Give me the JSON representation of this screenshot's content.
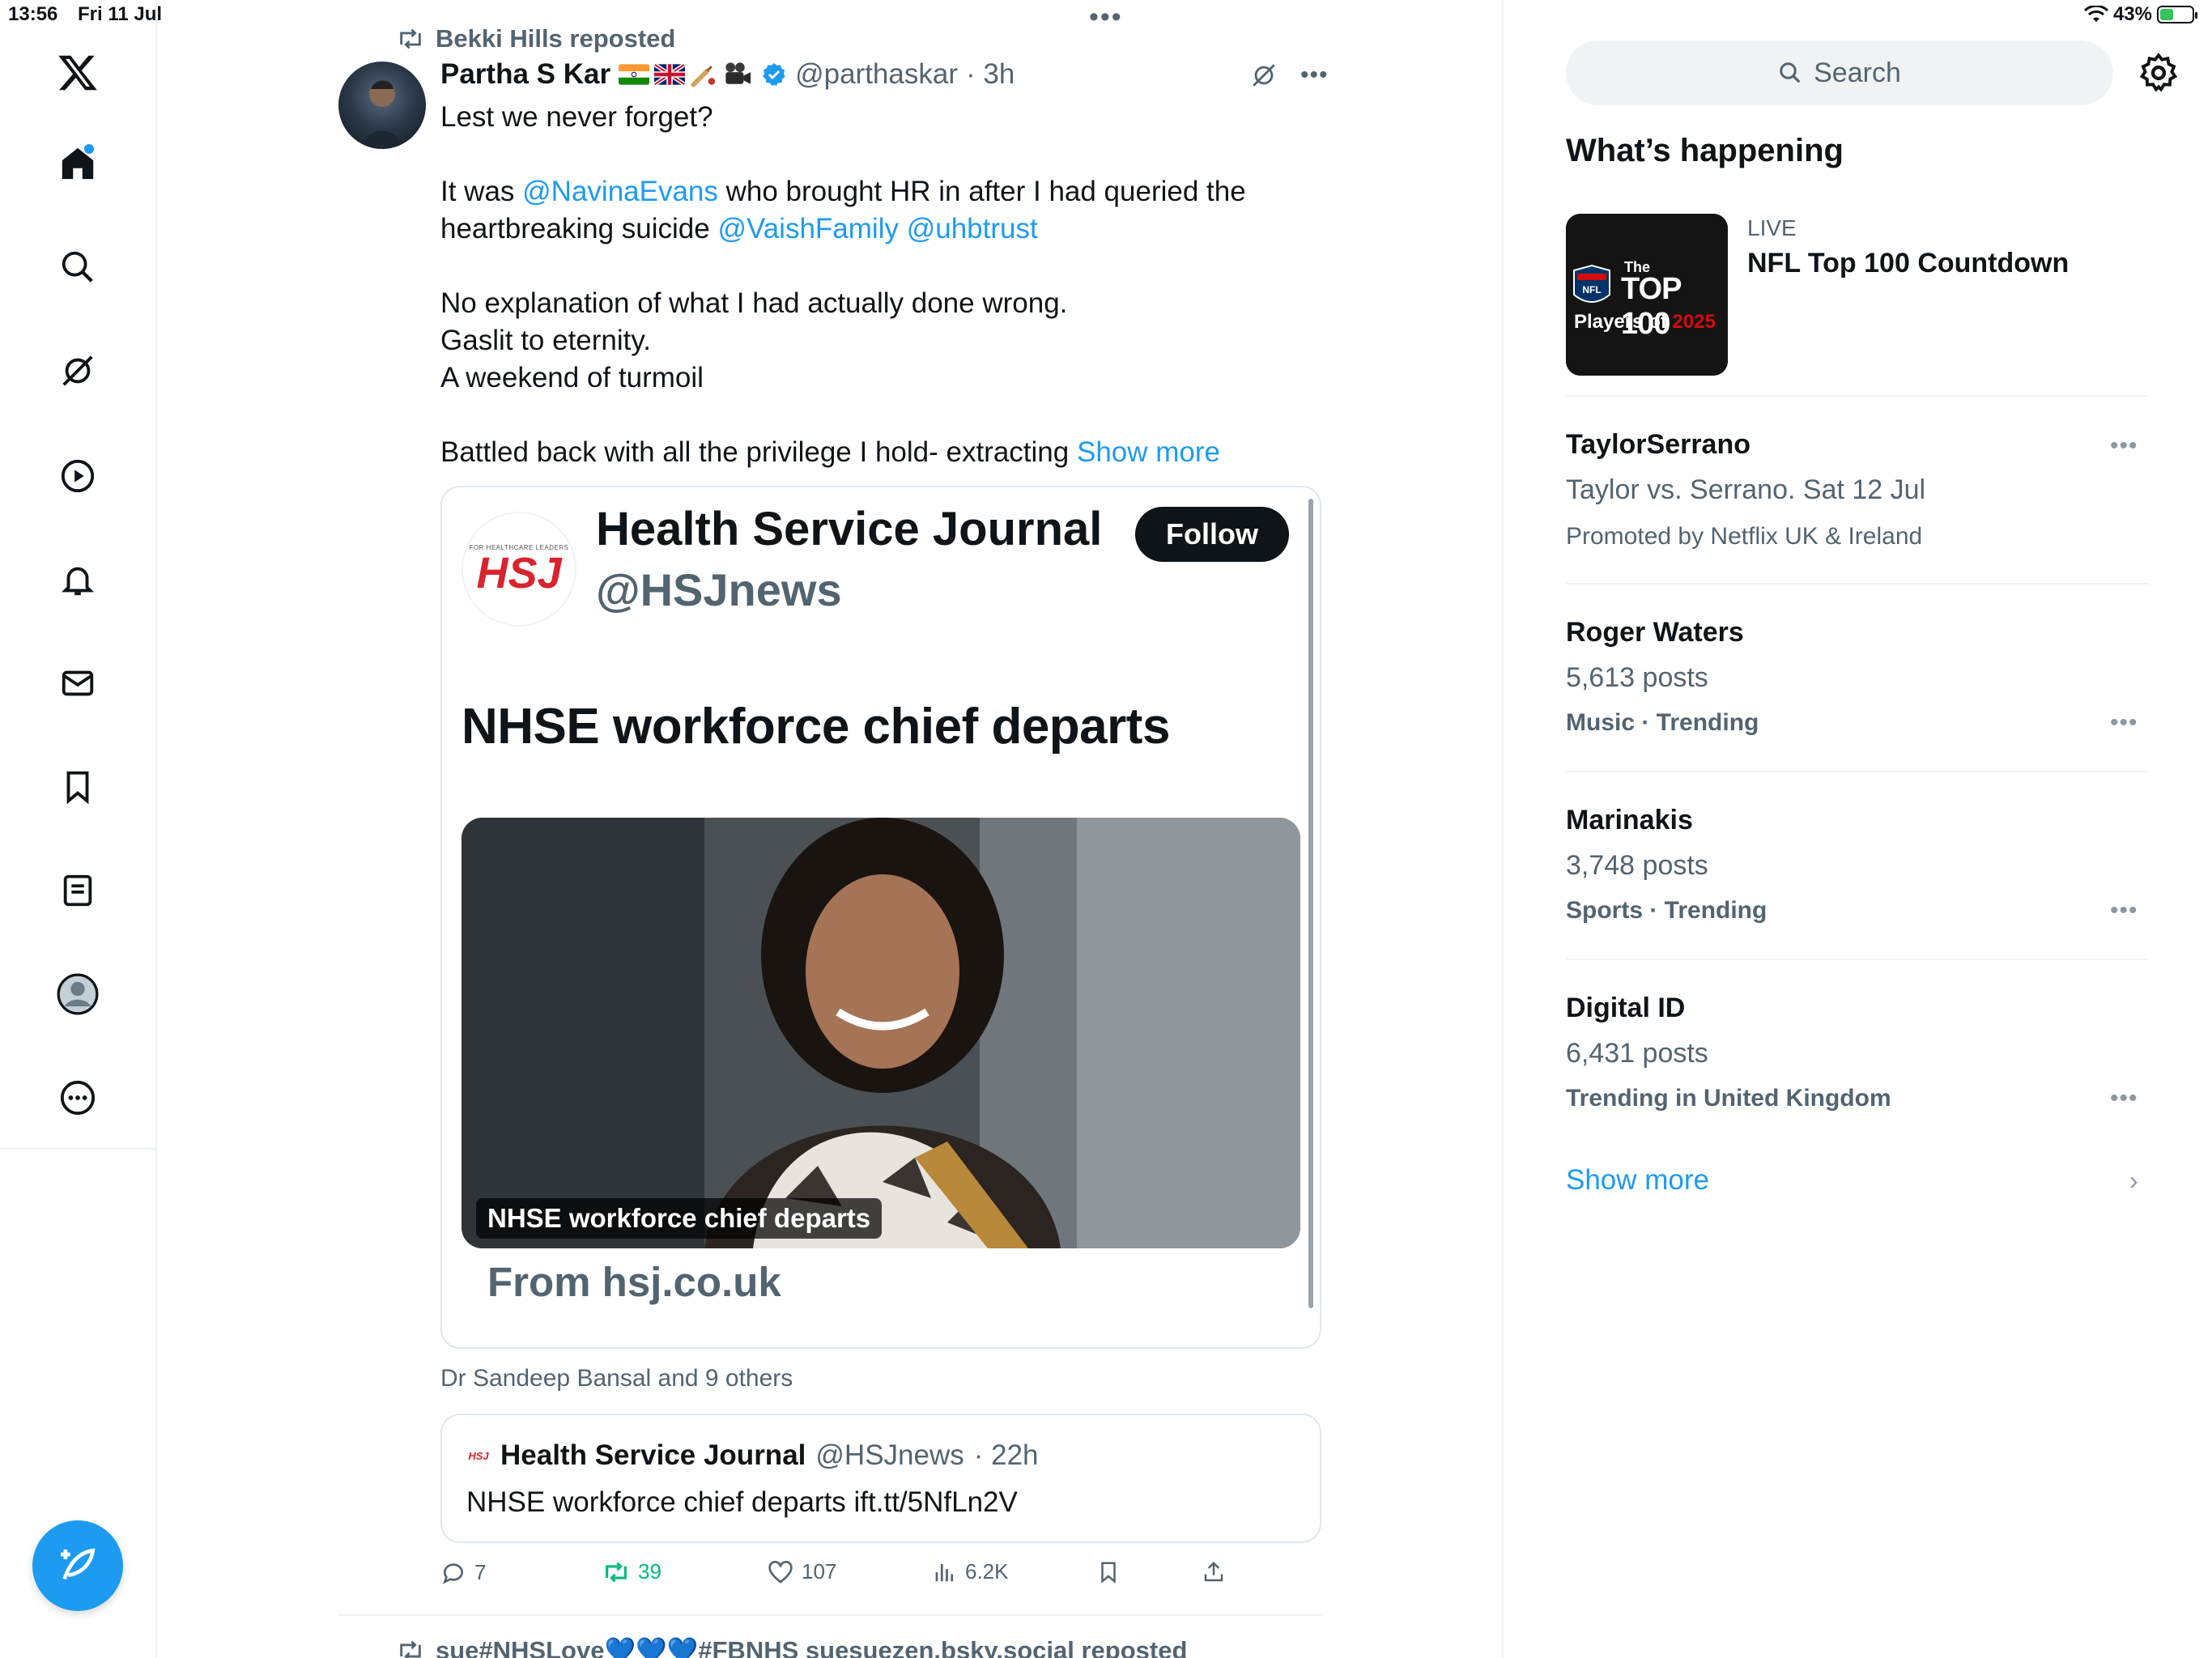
{
  "status_bar": {
    "time": "13:56",
    "date": "Fri 11 Jul",
    "battery": "43%",
    "battery_level": 0.43
  },
  "nav": {
    "items": [
      "home",
      "explore",
      "grok",
      "videos",
      "notifications",
      "messages",
      "bookmarks",
      "lists",
      "profile",
      "more"
    ],
    "compose": "compose-post"
  },
  "post": {
    "reposted_by": "Bekki Hills reposted",
    "author_name": "Partha S Kar",
    "author_handle": "@parthaskar",
    "time": "· 3h",
    "body_line1": "Lest we never forget?",
    "body_p2_a": "It was ",
    "mention1": "@NavinaEvans",
    "body_p2_b": " who brought HR in after I had queried the",
    "body_p2_c": "heartbreaking suicide ",
    "mention2": "@VaishFamily",
    "mention3": "@uhbtrust",
    "body_p3_l1": "No explanation of what I had actually done wrong.",
    "body_p3_l2": "Gaslit to eternity.",
    "body_p3_l3": "A weekend of turmoil",
    "body_p4": "Battled back with all the privilege I hold- extracting ",
    "show_more": "Show more",
    "card": {
      "logo_small": "FOR HEALTHCARE LEADERS",
      "logo_text": "HSJ",
      "name": "Health Service Journal",
      "handle": "@HSJnews",
      "follow": "Follow",
      "headline": "NHSE workforce chief departs",
      "image_caption": "NHSE workforce chief departs",
      "source": "From hsj.co.uk"
    },
    "liked_by": "Dr Sandeep Bansal and 9 others",
    "quote": {
      "logo": "HSJ",
      "name": "Health Service Journal",
      "handle": "@HSJnews",
      "time": "· 22h",
      "text": "NHSE workforce chief departs ift.tt/5NfLn2V"
    },
    "actions": {
      "replies": "7",
      "reposts": "39",
      "likes": "107",
      "views": "6.2K"
    }
  },
  "next_post": {
    "reposted_by": "sue#NHSLove💙💙💙#FBNHS suesuezen.bsky.social reposted"
  },
  "sidebar": {
    "search_placeholder": "Search",
    "section_title": "What’s happening",
    "live": {
      "label": "LIVE",
      "title": "NFL Top 100 Countdown",
      "thumb_line1": "The",
      "thumb_line2": "TOP 100",
      "thumb_line3a": "Players of ",
      "thumb_line3b": "2025"
    },
    "trends": [
      {
        "title": "TaylorSerrano",
        "sub": "Taylor vs. Serrano. Sat 12 Jul",
        "meta": "Promoted by Netflix UK & Ireland"
      },
      {
        "title": "Roger Waters",
        "sub": "5,613 posts",
        "meta": "Music · Trending"
      },
      {
        "title": "Marinakis",
        "sub": "3,748 posts",
        "meta": "Sports · Trending"
      },
      {
        "title": "Digital ID",
        "sub": "6,431 posts",
        "meta": "Trending in United Kingdom"
      }
    ],
    "show_more": "Show more"
  }
}
